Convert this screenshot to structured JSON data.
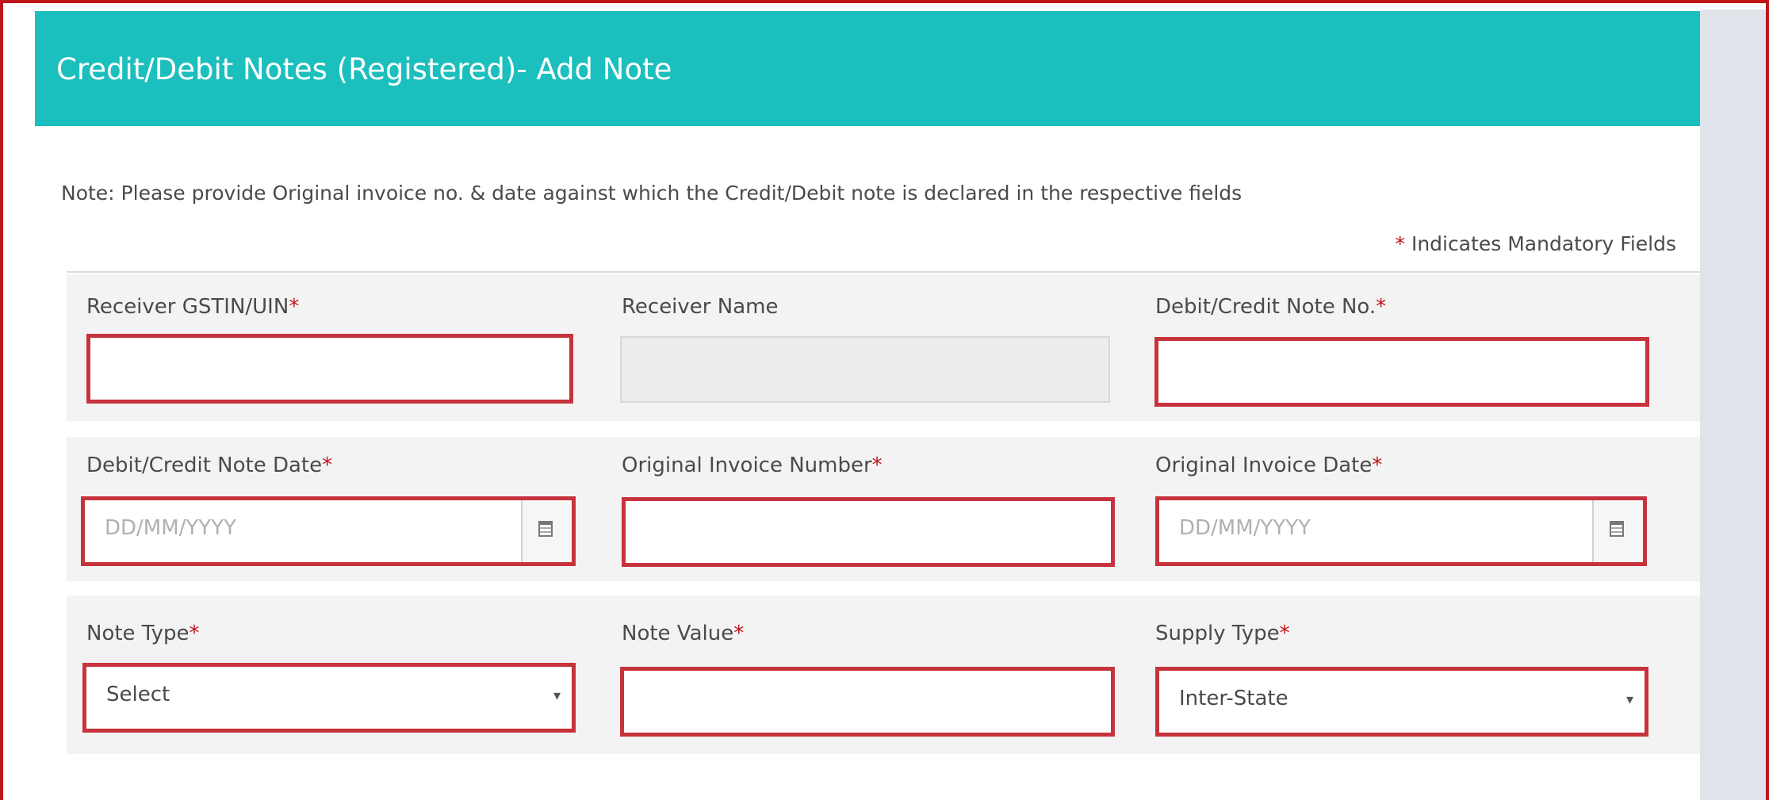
{
  "header": {
    "title": "Credit/Debit Notes (Registered)- Add Note"
  },
  "note": "Note: Please provide Original invoice no. & date against which the Credit/Debit note is declared in the respective fields",
  "mandatory_legend": {
    "star": "*",
    "text": "Indicates Mandatory Fields"
  },
  "colors": {
    "header_bg": "#1bbfbd",
    "error_border": "#c7333c",
    "required_star": "#c0151b"
  },
  "fields": {
    "receiver_gstin": {
      "label": "Receiver GSTIN/UIN",
      "star": "*",
      "value": ""
    },
    "receiver_name": {
      "label": "Receiver Name",
      "value": ""
    },
    "note_no": {
      "label": "Debit/Credit Note No.",
      "star": "*",
      "value": ""
    },
    "note_date": {
      "label": "Debit/Credit Note Date",
      "star": "*",
      "placeholder": "DD/MM/YYYY",
      "icon": "calendar-icon"
    },
    "orig_invoice_no": {
      "label": "Original Invoice Number",
      "star": "*",
      "value": ""
    },
    "orig_invoice_date": {
      "label": "Original Invoice Date",
      "star": "*",
      "placeholder": "DD/MM/YYYY",
      "icon": "calendar-icon"
    },
    "note_type": {
      "label": "Note Type",
      "star": "*",
      "selected": "Select",
      "caret": "▾"
    },
    "note_value": {
      "label": "Note Value",
      "star": "*",
      "value": ""
    },
    "supply_type": {
      "label": "Supply Type",
      "star": "*",
      "selected": "Inter-State",
      "caret": "▾"
    }
  }
}
